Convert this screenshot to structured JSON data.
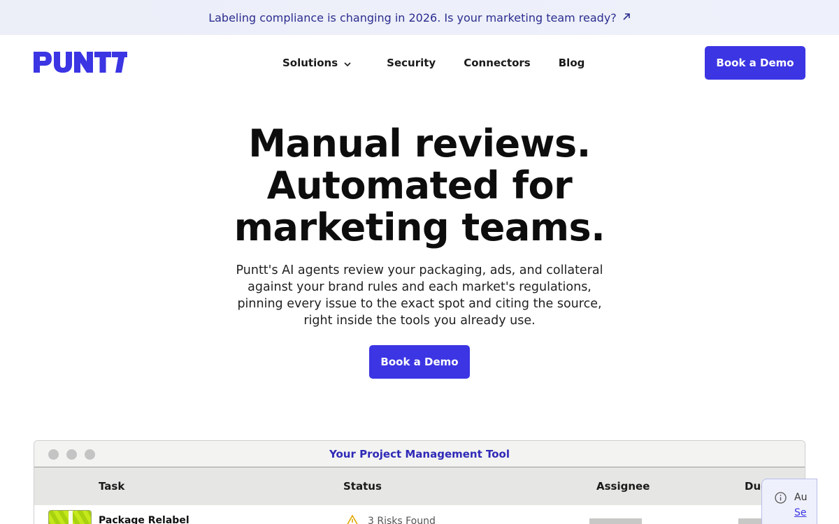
{
  "announcement": {
    "text": "Labeling compliance is changing in 2026. Is your marketing team ready?",
    "icon": "arrow-up-right-icon"
  },
  "nav": {
    "logo_text": "PUNTT",
    "links": [
      {
        "label": "Solutions",
        "icon": "chevron-down-icon"
      },
      {
        "label": "Security"
      },
      {
        "label": "Connectors"
      },
      {
        "label": "Blog"
      }
    ],
    "cta_label": "Book a Demo"
  },
  "hero": {
    "title_lines": [
      "Manual reviews.",
      "Automated for",
      "marketing teams."
    ],
    "subtitle_lines": [
      "Puntt's AI agents review your packaging, ads, and collateral",
      "against your brand rules and each market's regulations,",
      "pinning every issue to the exact spot and citing the source,",
      "right inside the tools you already use."
    ],
    "cta_label": "Book a Demo"
  },
  "mockup": {
    "window_title": "Your Project Management Tool",
    "columns": [
      "Task",
      "Status",
      "Assignee",
      "Due"
    ],
    "rows": [
      {
        "task": "Package Relabel",
        "status": "3 Risks Found",
        "status_icon": "warning-icon"
      }
    ],
    "popover": {
      "text": "Au",
      "link": "Se",
      "icon": "info-icon"
    }
  },
  "colors": {
    "brand": "#3b35e3",
    "announcement_text": "#2b2d8f",
    "announcement_bg": "#eceef8"
  }
}
